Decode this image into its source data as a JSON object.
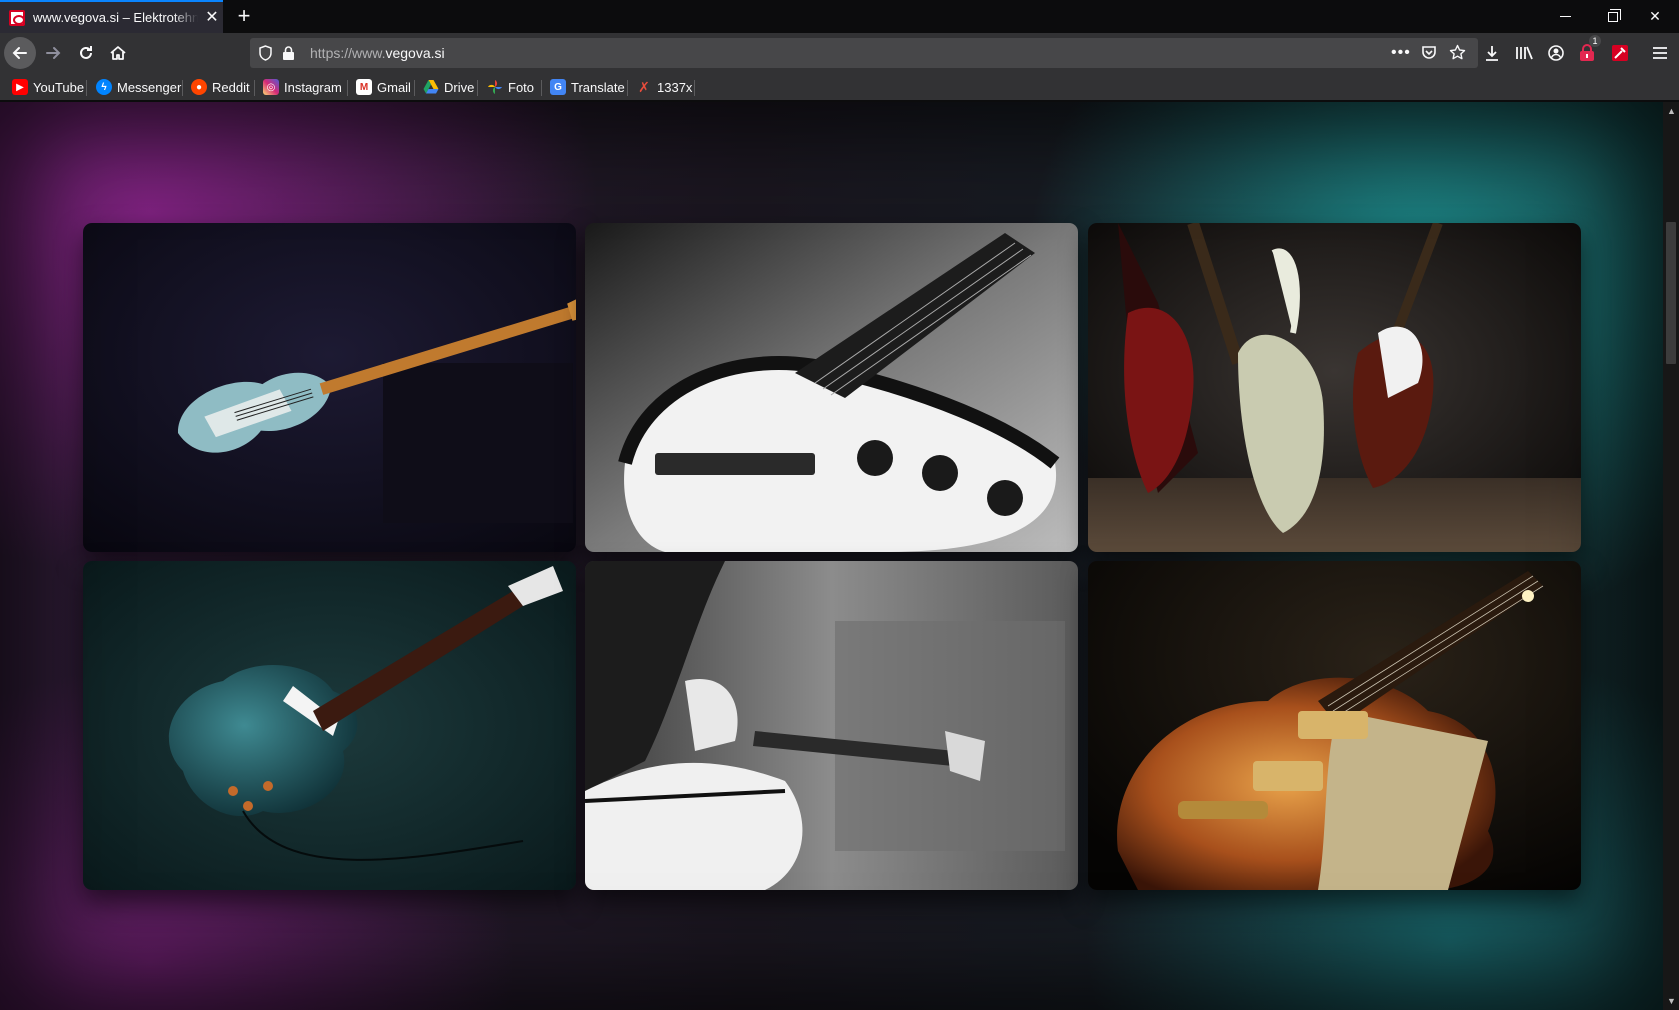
{
  "browser": {
    "tab_title": "www.vegova.si – Elektrotehniška",
    "new_tab_label": "+",
    "url_prefix": "https://www.",
    "url_domain": "vegova.si",
    "page_actions_label": "•••",
    "extension_badge": "1",
    "accent_color": "#0a84ff"
  },
  "bookmarks": [
    {
      "label": "YouTube",
      "icon": "youtube-icon",
      "color": "#ff0000"
    },
    {
      "label": "Messenger",
      "icon": "messenger-icon",
      "color": "#0084ff"
    },
    {
      "label": "Reddit",
      "icon": "reddit-icon",
      "color": "#ff4500"
    },
    {
      "label": "Instagram",
      "icon": "instagram-icon",
      "color": "#c13584"
    },
    {
      "label": "Gmail",
      "icon": "gmail-icon",
      "color": "#d93025"
    },
    {
      "label": "Drive",
      "icon": "drive-icon",
      "color": "#1fa463"
    },
    {
      "label": "Foto",
      "icon": "photos-icon",
      "color": "#fbbc04"
    },
    {
      "label": "Translate",
      "icon": "translate-icon",
      "color": "#4285f4"
    },
    {
      "label": "1337x",
      "icon": "1337x-icon",
      "color": "#e74c3c"
    }
  ],
  "gallery": {
    "images": [
      {
        "name": "guitar-strat-blue-dark"
      },
      {
        "name": "guitar-strat-bw-closeup"
      },
      {
        "name": "guitar-three-firebirds"
      },
      {
        "name": "guitar-lespaul-teal"
      },
      {
        "name": "guitar-player-bw"
      },
      {
        "name": "guitar-lespaul-sunburst"
      }
    ]
  },
  "page_colors": {
    "background_left": "#8c238c",
    "background_right": "#1e9696"
  }
}
